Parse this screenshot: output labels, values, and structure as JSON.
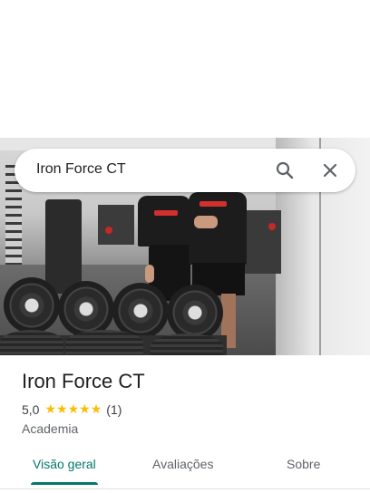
{
  "search": {
    "query": "Iron Force CT",
    "search_icon": "search-icon",
    "close_icon": "close-icon"
  },
  "place": {
    "name": "Iron Force CT",
    "rating": "5,0",
    "stars": [
      "★",
      "★",
      "★",
      "★",
      "★"
    ],
    "star_count": 5,
    "review_count": "(1)",
    "category": "Academia"
  },
  "tabs": [
    {
      "label": "Visão geral",
      "active": true
    },
    {
      "label": "Avaliações",
      "active": false
    },
    {
      "label": "Sobre",
      "active": false
    }
  ],
  "colors": {
    "accent": "#00796b",
    "star": "#fbbc04",
    "text_primary": "#202124",
    "text_secondary": "#5f6368"
  },
  "photo": {
    "subject": "gym-interior-photo"
  }
}
